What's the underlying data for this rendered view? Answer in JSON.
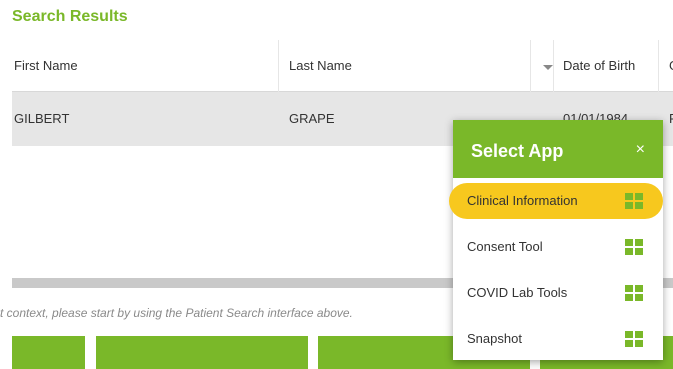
{
  "results": {
    "title": "Search Results",
    "columns": [
      "First Name",
      "Last Name",
      "Date of Birth",
      "G"
    ],
    "rows": [
      {
        "first_name": "GILBERT",
        "last_name": "GRAPE",
        "dob": "01/01/1984",
        "extra": "F"
      }
    ],
    "hint": "t context, please start by using the Patient Search interface above."
  },
  "popup": {
    "title": "Select App",
    "close": "×",
    "apps": [
      {
        "label": "Clinical Information",
        "icon": "grid-icon",
        "selected": true
      },
      {
        "label": "Consent Tool",
        "icon": "grid-icon",
        "selected": false
      },
      {
        "label": "COVID Lab Tools",
        "icon": "grid-icon",
        "selected": false
      },
      {
        "label": "Snapshot",
        "icon": "grid-icon",
        "selected": false
      }
    ]
  },
  "colors": {
    "accent": "#7ab829",
    "highlight": "#f7c81e",
    "row_bg": "#e6e6e6"
  }
}
